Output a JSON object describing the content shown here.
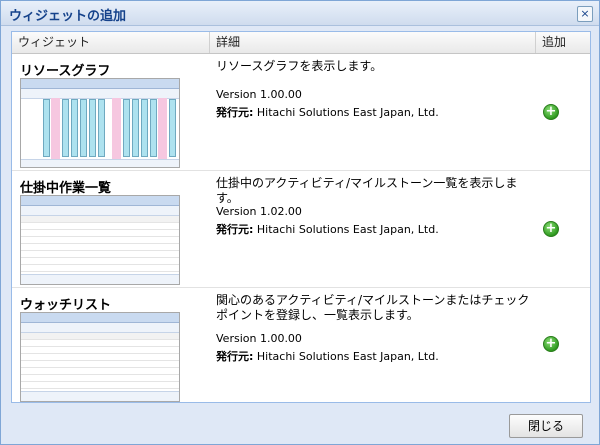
{
  "dialog": {
    "title": "ウィジェットの追加",
    "close_icon": "close-icon",
    "close_glyph": "×",
    "close_button_label": "閉じる"
  },
  "table": {
    "columns": [
      "ウィジェット",
      "詳細",
      "追加"
    ]
  },
  "widgets": [
    {
      "name": "リソースグラフ",
      "description": "リソースグラフを表示します。",
      "version": "Version 1.00.00",
      "publisher_label": "発行元:",
      "publisher": "Hitachi Solutions East Japan, Ltd.",
      "add_icon": "add-icon",
      "add_glyph": "+"
    },
    {
      "name": "仕掛中作業一覧",
      "description": "仕掛中のアクティビティ/マイルストーン一覧を表示します。",
      "version": "Version 1.02.00",
      "publisher_label": "発行元:",
      "publisher": "Hitachi Solutions East Japan, Ltd.",
      "add_icon": "add-icon",
      "add_glyph": "+"
    },
    {
      "name": "ウォッチリスト",
      "description": "関心のあるアクティビティ/マイルストーンまたはチェックポイントを登録し、一覧表示します。",
      "version": "Version 1.00.00",
      "publisher_label": "発行元:",
      "publisher": "Hitachi Solutions East Japan, Ltd.",
      "add_icon": "add-icon",
      "add_glyph": "+"
    }
  ],
  "colors": {
    "title_text": "#15428b",
    "frame_border": "#7fa6d6",
    "add_green": "#2f9a1f"
  }
}
